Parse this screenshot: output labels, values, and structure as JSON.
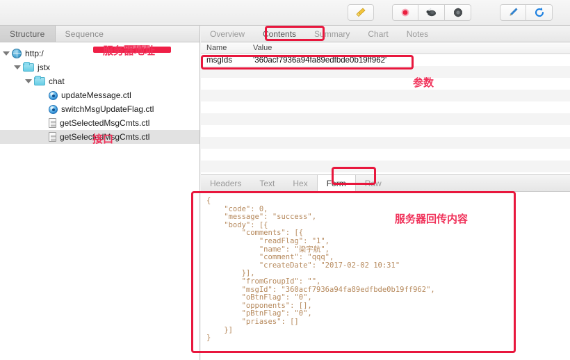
{
  "toolbar": {
    "buttons": [
      {
        "name": "clear-session-icon",
        "icon": "broom"
      },
      {
        "name": "record-icon",
        "icon": "record"
      },
      {
        "name": "throttle-icon",
        "icon": "turtle"
      },
      {
        "name": "breakpoints-icon",
        "icon": "gear"
      },
      {
        "name": "compose-icon",
        "icon": "pen"
      },
      {
        "name": "repeat-icon",
        "icon": "refresh"
      }
    ]
  },
  "left_panel": {
    "tabs": [
      {
        "label": "Structure",
        "selected": true
      },
      {
        "label": "Sequence",
        "selected": false
      }
    ],
    "tree": [
      {
        "label": "http:/",
        "icon": "globe-icon",
        "depth": 0,
        "twisty": true,
        "redacted": true,
        "selected": false
      },
      {
        "label": "jstx",
        "icon": "folder-icon",
        "depth": 1,
        "twisty": true,
        "redacted": false,
        "selected": false
      },
      {
        "label": "chat",
        "icon": "folder-icon",
        "depth": 2,
        "twisty": true,
        "redacted": false,
        "selected": false
      },
      {
        "label": "updateMessage.ctl",
        "icon": "endpoint-icon",
        "depth": 3,
        "twisty": false,
        "redacted": false,
        "selected": false
      },
      {
        "label": "switchMsgUpdateFlag.ctl",
        "icon": "endpoint-icon",
        "depth": 3,
        "twisty": false,
        "redacted": false,
        "selected": false
      },
      {
        "label": "getSelectedMsgCmts.ctl",
        "icon": "doc-icon",
        "depth": 3,
        "twisty": false,
        "redacted": false,
        "selected": false
      },
      {
        "label": "getSelectedMsgCmts.ctl",
        "icon": "doc-icon",
        "depth": 3,
        "twisty": false,
        "redacted": false,
        "selected": true
      }
    ]
  },
  "right_panel": {
    "tabs": [
      {
        "label": "Overview",
        "selected": false
      },
      {
        "label": "Contents",
        "selected": true
      },
      {
        "label": "Summary",
        "selected": false
      },
      {
        "label": "Chart",
        "selected": false
      },
      {
        "label": "Notes",
        "selected": false
      }
    ],
    "params_table": {
      "headers": [
        "Name",
        "Value"
      ],
      "rows": [
        {
          "name": "msgIds",
          "value": "'360acf7936a94fa89edfbde0b19ff962'"
        }
      ],
      "empty_row_count": 11
    },
    "body_tabs": [
      {
        "label": "Headers",
        "selected": false
      },
      {
        "label": "Text",
        "selected": false
      },
      {
        "label": "Hex",
        "selected": false
      },
      {
        "label": "Form",
        "selected": true
      },
      {
        "label": "Raw",
        "selected": false
      }
    ],
    "body_json": "{\n    \"code\": 0,\n    \"message\": \"success\",\n    \"body\": [{\n        \"comments\": [{\n            \"readFlag\": \"1\",\n            \"name\": \"梁宇航\",\n            \"comment\": \"qqq\",\n            \"createDate\": \"2017-02-02 10:31\"\n        }],\n        \"fromGroupId\": \"\",\n        \"msgId\": \"360acf7936a94fa89edfbde0b19ff962\",\n        \"oBtnFlag\": \"0\",\n        \"opponents\": [],\n        \"pBtnFlag\": \"0\",\n        \"priases\": []\n    }]\n}"
  },
  "annotations": {
    "server_address": "服务器地址",
    "interface": "接口",
    "parameters": "参数",
    "response_content": "服务器回传内容"
  },
  "colors": {
    "annotation_red": "#e8173d",
    "annotation_text": "#f0325a",
    "json_text": "#b6895c",
    "selected_row": "#e2e2e2"
  }
}
